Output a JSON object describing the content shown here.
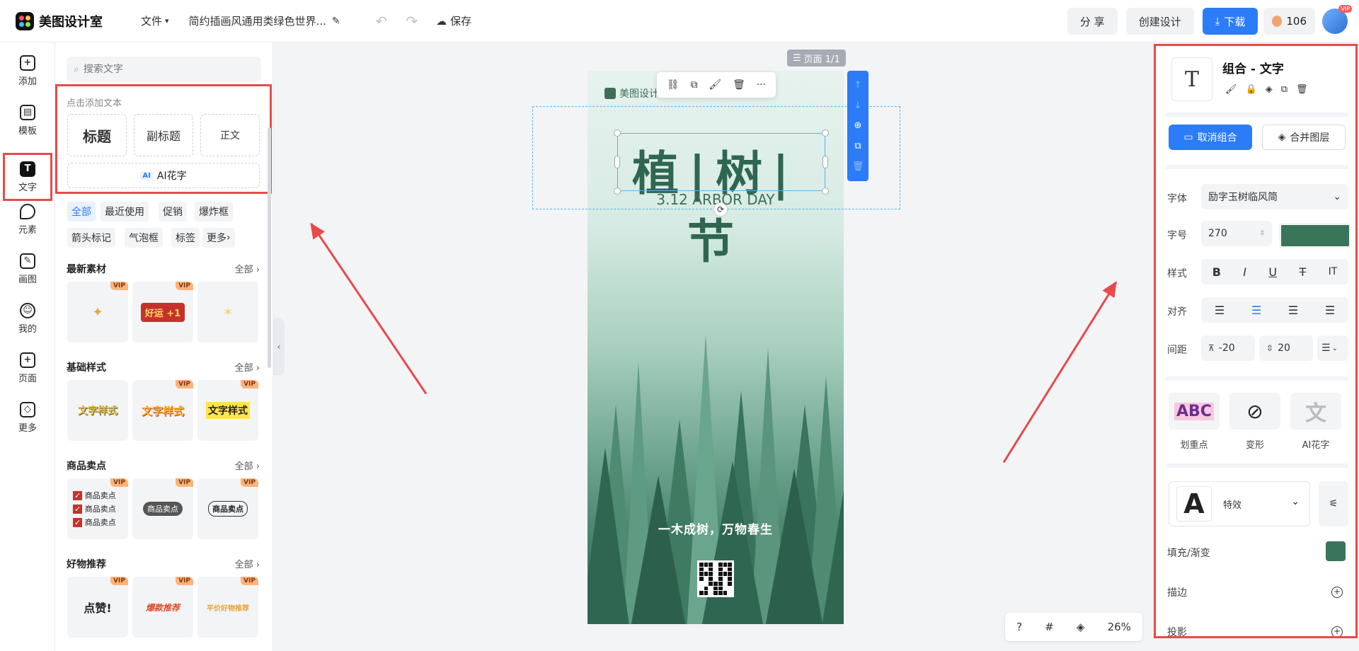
{
  "app": {
    "name": "美图设计室"
  },
  "topbar": {
    "file_menu": "文件",
    "doc_title": "简约插画风通用类绿色世界...",
    "save": "保存",
    "share": "分 享",
    "create": "创建设计",
    "download": "下载",
    "coins": "106",
    "vip": "VIP"
  },
  "rail": {
    "items": [
      "添加",
      "模板",
      "文字",
      "元素",
      "画图",
      "我的",
      "页面",
      "更多"
    ]
  },
  "panel": {
    "search_placeholder": "搜索文字",
    "add_text_label": "点击添加文本",
    "add_title": "标题",
    "add_subtitle": "副标题",
    "add_body": "正文",
    "ai_badge": "AI",
    "ai_text": "AI花字",
    "chips": [
      "全部",
      "最近使用",
      "促销",
      "爆炸框",
      "箭头标记",
      "气泡框",
      "标签",
      "更多"
    ],
    "all_label": "全部",
    "sections": [
      "最新素材",
      "基础样式",
      "商品卖点",
      "好物推荐"
    ],
    "tiles": {
      "t1": "好运 +1",
      "t2": "文字样式",
      "t3": "文字样式",
      "t4": "文字样式",
      "t5": "商品卖点",
      "t6": "商品卖点",
      "t7": "商品卖点",
      "t8": "点赞!",
      "t9": "爆款推荐",
      "t10": "平价好物推荐"
    },
    "vip_tag": "VIP"
  },
  "canvas": {
    "page_badge": "页面 1/1",
    "brand": "美图设计",
    "title": "植|树|节",
    "subtitle": "3.12 ARBOR DAY",
    "slogan": "一木成树，万物春生",
    "zoom": "26%"
  },
  "right": {
    "title": "组合 - 文字",
    "ungroup": "取消组合",
    "merge": "合并图层",
    "font_label": "字体",
    "font_value": "励字玉树临风简",
    "size_label": "字号",
    "size_value": "270",
    "style_label": "样式",
    "align_label": "对齐",
    "spacing_label": "间距",
    "letter_spacing": "-20",
    "line_spacing": "20",
    "card1": "划重点",
    "card2": "变形",
    "card3": "AI花字",
    "effect": "特效",
    "fill_label": "填充/渐变",
    "stroke_label": "描边",
    "shadow_label": "投影",
    "text_color": "#3a7559"
  }
}
